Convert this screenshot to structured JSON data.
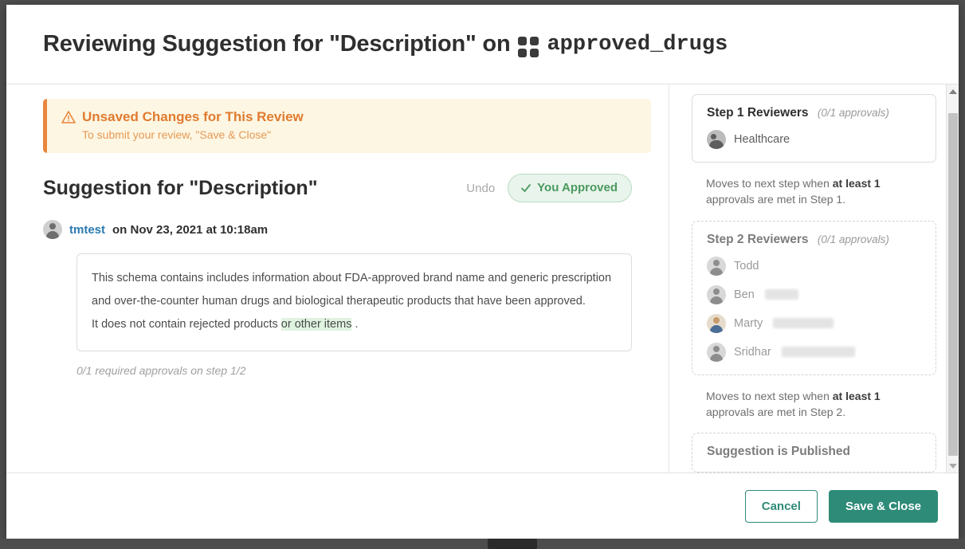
{
  "header": {
    "title_prefix": "Reviewing Suggestion for \"Description\" on",
    "dataset_name": "approved_drugs",
    "dataset_icon": "grid-four-squares-icon"
  },
  "banner": {
    "icon": "warning-triangle-icon",
    "title": "Unsaved Changes for This Review",
    "subtitle": "To submit your review, \"Save & Close\"",
    "accent_color": "#e8863c",
    "background_color": "#fdf6e3"
  },
  "suggestion": {
    "title": "Suggestion for \"Description\"",
    "undo_label": "Undo",
    "approved_label": "You Approved",
    "approved_check_icon": "check-icon",
    "approved_color": "#4a9a5e",
    "author": "tmtest",
    "author_meta": "on Nov 23, 2021 at 10:18am",
    "author_avatar_icon": "user-avatar-icon",
    "body": {
      "part1": "This schema contains includes information about FDA-approved brand name and generic prescription and over-the-counter human drugs and biological therapeutic products that have been approved.",
      "deleted_whitespace": " ",
      "inserted_whitespace": " ",
      "part2": "It does not contain rejected products",
      "inserted_text": "or other items",
      "part3": ".",
      "insert_color": "#dff3e0",
      "delete_color": "#fbdfdf"
    },
    "approvals_note": "0/1 required approvals on step 1/2"
  },
  "sidebar": {
    "step1": {
      "title": "Step 1 Reviewers",
      "count": "(0/1 approvals)",
      "reviewers": [
        {
          "name": "Healthcare",
          "avatar": "group-avatar-icon",
          "redacted_width": 0
        }
      ]
    },
    "step1_note_prefix": "Moves to next step when ",
    "step1_note_bold": "at least 1",
    "step1_note_suffix": " approvals are met in Step 1.",
    "step2": {
      "title": "Step 2 Reviewers",
      "count": "(0/1 approvals)",
      "reviewers": [
        {
          "name": "Todd",
          "avatar": "user-avatar-icon",
          "redacted_width": 0
        },
        {
          "name": "Ben",
          "avatar": "user-avatar-icon",
          "redacted_width": 42
        },
        {
          "name": "Marty",
          "avatar": "photo-avatar-icon",
          "redacted_width": 76
        },
        {
          "name": "Sridhar",
          "avatar": "user-avatar-icon",
          "redacted_width": 92
        }
      ]
    },
    "step2_note_prefix": "Moves to next step when ",
    "step2_note_bold": "at least 1",
    "step2_note_suffix": " approvals are met in Step 2.",
    "published": {
      "title": "Suggestion is Published"
    }
  },
  "scrollbar": {
    "up_icon": "caret-up-icon",
    "down_icon": "caret-down-icon"
  },
  "footer": {
    "cancel_label": "Cancel",
    "save_label": "Save & Close",
    "primary_color": "#2e8b78"
  }
}
